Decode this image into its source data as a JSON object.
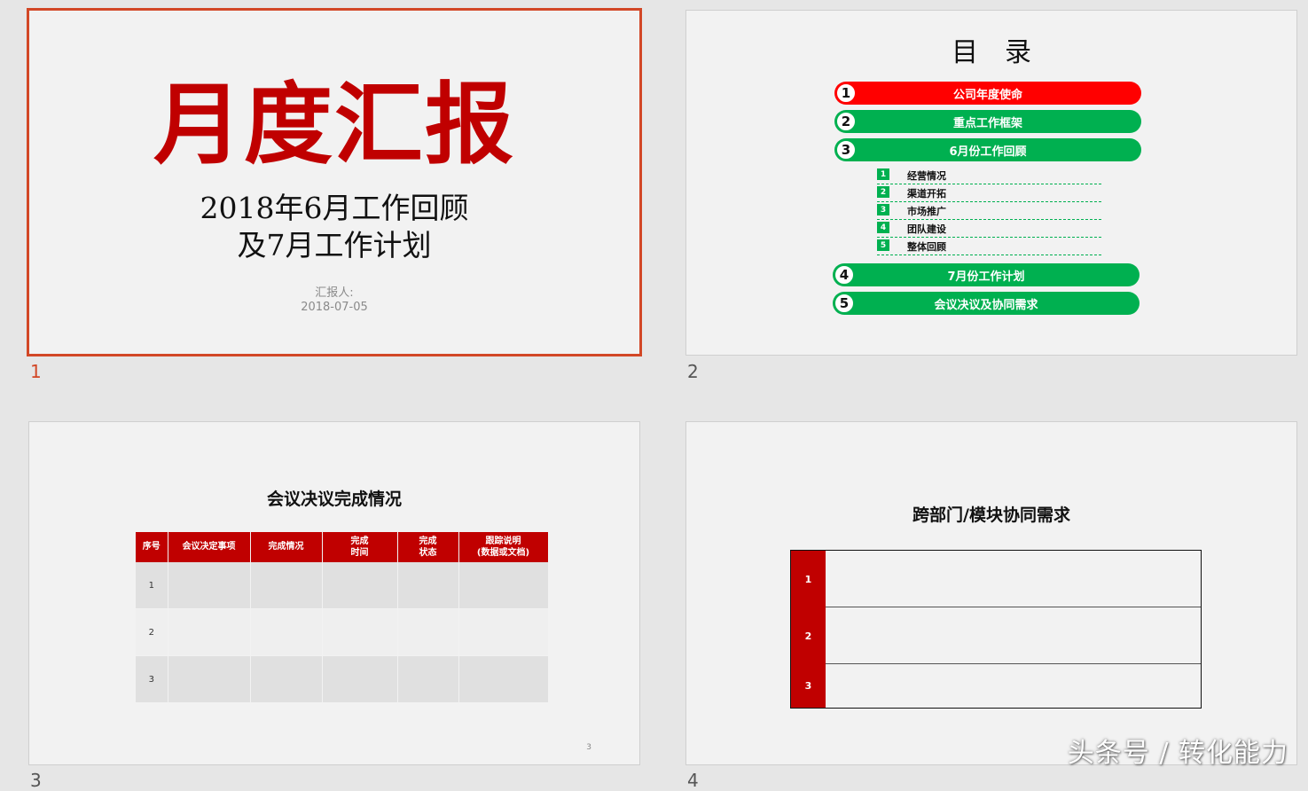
{
  "slides": [
    {
      "number": "1",
      "selected": true,
      "title": "月度汇报",
      "subtitle_line1": "2018年6月工作回顾",
      "subtitle_line2": "及7月工作计划",
      "reporter_label": "汇报人:",
      "date": "2018-07-05"
    },
    {
      "number": "2",
      "title": "目录",
      "items": [
        {
          "num": "1",
          "label": "公司年度使命"
        },
        {
          "num": "2",
          "label": "重点工作框架"
        },
        {
          "num": "3",
          "label": "6月份工作回顾"
        },
        {
          "num": "4",
          "label": "7月份工作计划"
        },
        {
          "num": "5",
          "label": "会议决议及协同需求"
        }
      ],
      "subitems": [
        {
          "num": "1",
          "label": "经营情况"
        },
        {
          "num": "2",
          "label": "渠道开拓"
        },
        {
          "num": "3",
          "label": "市场推广"
        },
        {
          "num": "4",
          "label": "团队建设"
        },
        {
          "num": "5",
          "label": "整体回顾"
        }
      ]
    },
    {
      "number": "3",
      "title": "会议决议完成情况",
      "headers": [
        "序号",
        "会议决定事项",
        "完成情况",
        "完成\n时间",
        "完成\n状态",
        "跟踪说明\n(数据或文档)"
      ],
      "rows": [
        "1",
        "2",
        "3"
      ],
      "page_number": "3"
    },
    {
      "number": "4",
      "title": "跨部门/模块协同需求",
      "rows": [
        "1",
        "2",
        "3"
      ]
    }
  ],
  "colors": {
    "accent_red": "#c00000",
    "toc_red": "#ff0000",
    "toc_green": "#00b050",
    "selection": "#d24726"
  },
  "watermark": "头条号 / 转化能力"
}
